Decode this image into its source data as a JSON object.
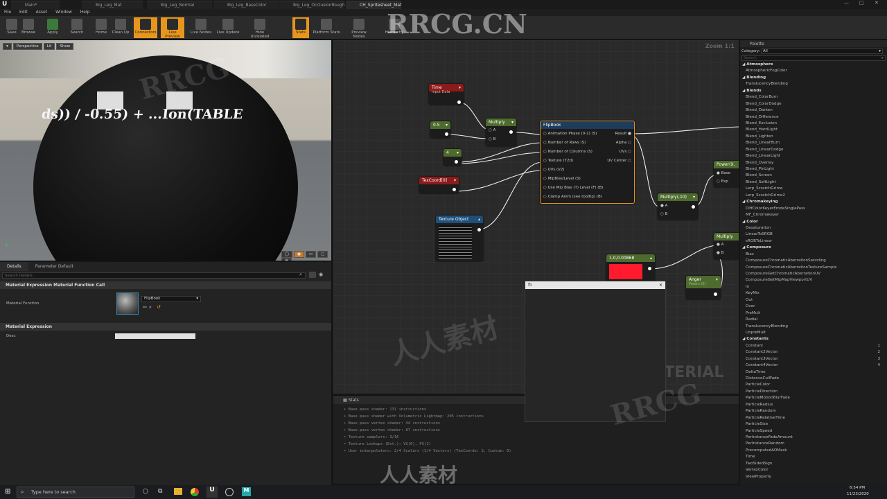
{
  "window": {
    "tabs": [
      "Main*",
      "Big_Leg_Mat",
      "Big_Leg_Normal",
      "Big_Leg_BaseColor",
      "Big_Leg_OcclusionRough",
      "CH_Spritesheet_Mat"
    ]
  },
  "menu": [
    "File",
    "Edit",
    "Asset",
    "Window",
    "Help"
  ],
  "toolbar": [
    {
      "label": "Save",
      "icon": "save-icon",
      "active": false
    },
    {
      "label": "Browse",
      "icon": "browse-icon",
      "active": false
    },
    {
      "label": "Apply",
      "icon": "checkmark-icon",
      "active": false
    },
    {
      "label": "Search",
      "icon": "binoculars-icon",
      "active": false
    },
    {
      "label": "Home",
      "icon": "home-icon",
      "active": false
    },
    {
      "label": "Clean Up",
      "icon": "broom-icon",
      "active": false
    },
    {
      "label": "Connectors",
      "icon": "connectors-icon",
      "active": true
    },
    {
      "label": "Live Preview",
      "icon": "live-preview-icon",
      "active": true
    },
    {
      "label": "Live Nodes",
      "icon": "live-nodes-icon",
      "active": false
    },
    {
      "label": "Live Update",
      "icon": "live-update-icon",
      "active": false
    },
    {
      "label": "Hide Unrelated",
      "icon": "hide-unrelated-icon",
      "active": false
    },
    {
      "label": "Stats",
      "icon": "stats-icon",
      "active": true
    },
    {
      "label": "Platform Stats",
      "icon": "platform-stats-icon",
      "active": false
    },
    {
      "label": "Preview Nodes",
      "icon": "preview-nodes-icon",
      "active": false
    },
    {
      "label": "Hierarchy",
      "icon": "hierarchy-icon",
      "active": false
    }
  ],
  "viewport": {
    "buttons": [
      "Perspective",
      "Lit",
      "Show"
    ],
    "sphere_text": "ds)) / -0.55) + ...Ion(TABLE"
  },
  "details": {
    "tabs": [
      "Details",
      "Parameter Default"
    ],
    "search_placeholder": "Search Details",
    "section1": "Material Expression Material Function Call",
    "function_label": "Material Function",
    "function_value": "FlipBook",
    "section2": "Material Expression",
    "desc_label": "Desc"
  },
  "graph": {
    "zoom": "Zoom 1:1",
    "watermark": "MATERIAL",
    "nodes": {
      "time": {
        "title": "Time",
        "subtitle": "Input Data"
      },
      "c05": {
        "title": "0.5"
      },
      "c4": {
        "title": "4"
      },
      "multiply1": {
        "title": "Multiply",
        "a": "A",
        "b": "B"
      },
      "texcoord": {
        "title": "TexCoord[0]"
      },
      "texobj": {
        "title": "Texture Object"
      },
      "flipbook": {
        "title": "FlipBook",
        "inputs": [
          "Animation Phase (0-1) (S)",
          "Number of Rows (S)",
          "Number of Columns (S)",
          "Texture (T2d)",
          "UVs (V2)",
          "MipBias/Level (S)",
          "Use Mip Bias (T) Level (F) (B)",
          "Clamp Anim (see tooltip) (B)"
        ],
        "outputs": [
          "Result",
          "Alpha",
          "UVs",
          "UV Center"
        ]
      },
      "multiply10": {
        "title": "Multiply(,10)",
        "a": "A",
        "b": "B"
      },
      "power": {
        "title": "Power(X,",
        "base": "Base",
        "exp": "Exp"
      },
      "multiply2": {
        "title": "Multiply",
        "a": "A",
        "b": "B"
      },
      "color": {
        "title": "1,0,0.00868"
      },
      "anger": {
        "title": "Anger",
        "subtitle": "Param (0)"
      }
    },
    "popup_search": "fli"
  },
  "stats": {
    "title": "Stats",
    "lines": [
      "Base pass shader: 131 instructions",
      "Base pass shader with Volumetric Lightmap: 205 instructions",
      "Base pass vertex shader: 44 instructions",
      "Base pass vertex shader: 87 instructions",
      "Texture samplers: 3/16",
      "Texture Lookups (Est.): VS(0), PS(1)",
      "User interpolators: 2/4 Scalars (1/4 Vectors) (TexCoords: 2, Custom: 0)"
    ]
  },
  "palette": {
    "title": "Palette",
    "category_label": "Category:",
    "category_value": "All",
    "search_placeholder": "Search",
    "items": [
      {
        "t": "Atmosphere",
        "cat": true
      },
      {
        "t": "AtmosphericFogColor"
      },
      {
        "t": "Blending",
        "cat": true
      },
      {
        "t": "TranslucencyBlending"
      },
      {
        "t": "Blends",
        "cat": true
      },
      {
        "t": "Blend_ColorBurn"
      },
      {
        "t": "Blend_ColorDodge"
      },
      {
        "t": "Blend_Darken"
      },
      {
        "t": "Blend_Difference"
      },
      {
        "t": "Blend_Exclusion"
      },
      {
        "t": "Blend_HardLight"
      },
      {
        "t": "Blend_Lighten"
      },
      {
        "t": "Blend_LinearBurn"
      },
      {
        "t": "Blend_LinearDodge"
      },
      {
        "t": "Blend_LinearLight"
      },
      {
        "t": "Blend_Overlay"
      },
      {
        "t": "Blend_PinLight"
      },
      {
        "t": "Blend_Screen"
      },
      {
        "t": "Blend_SoftLight"
      },
      {
        "t": "Lerp_ScratchGrime"
      },
      {
        "t": "Lerp_ScratchGrime2"
      },
      {
        "t": "Chromakeying",
        "cat": true
      },
      {
        "t": "DiffColorKeyerErodeSinglePass"
      },
      {
        "t": "MF_Chromakeyer"
      },
      {
        "t": "Color",
        "cat": true
      },
      {
        "t": "Desaturation"
      },
      {
        "t": "LinearToSRGB"
      },
      {
        "t": "sRGBToLinear"
      },
      {
        "t": "Composure",
        "cat": true
      },
      {
        "t": "Bias"
      },
      {
        "t": "ComposureChromaticAberrationSwizzling"
      },
      {
        "t": "ComposureChromaticAberrationTextureSample"
      },
      {
        "t": "ComposureGetChromaticAberrationUV"
      },
      {
        "t": "ComposureGetMipMapViewportUV"
      },
      {
        "t": "In"
      },
      {
        "t": "KeyMix"
      },
      {
        "t": "Out"
      },
      {
        "t": "Over"
      },
      {
        "t": "PreMult"
      },
      {
        "t": "Radial"
      },
      {
        "t": "TranslucencyBlending"
      },
      {
        "t": "UnpreMult"
      },
      {
        "t": "Constants",
        "cat": true
      },
      {
        "t": "Constant",
        "n": "1"
      },
      {
        "t": "Constant2Vector",
        "n": "2"
      },
      {
        "t": "Constant3Vector",
        "n": "3"
      },
      {
        "t": "Constant4Vector",
        "n": "4"
      },
      {
        "t": "DeltaTime"
      },
      {
        "t": "DistanceCullFade"
      },
      {
        "t": "ParticleColor"
      },
      {
        "t": "ParticleDirection"
      },
      {
        "t": "ParticleMotionBlurFade"
      },
      {
        "t": "ParticleRadius"
      },
      {
        "t": "ParticleRandom"
      },
      {
        "t": "ParticleRelativeTime"
      },
      {
        "t": "ParticleSize"
      },
      {
        "t": "ParticleSpeed"
      },
      {
        "t": "PerInstanceFadeAmount"
      },
      {
        "t": "PerInstanceRandom"
      },
      {
        "t": "PrecomputedAOMask"
      },
      {
        "t": "Time"
      },
      {
        "t": "TwoSidedSign"
      },
      {
        "t": "VertexColor"
      },
      {
        "t": "ViewProperty"
      }
    ]
  },
  "taskbar": {
    "search_placeholder": "Type here to search",
    "time": "6:54 PM",
    "date": "11/23/2020"
  },
  "watermarks": {
    "brand": "RRCG.CN",
    "cn": "人人素材",
    "rrcg": "RRCG"
  },
  "colors": {
    "accent": "#e6961e",
    "node_selected": "#e6961e",
    "red_swatch": "#ff1a2e"
  }
}
